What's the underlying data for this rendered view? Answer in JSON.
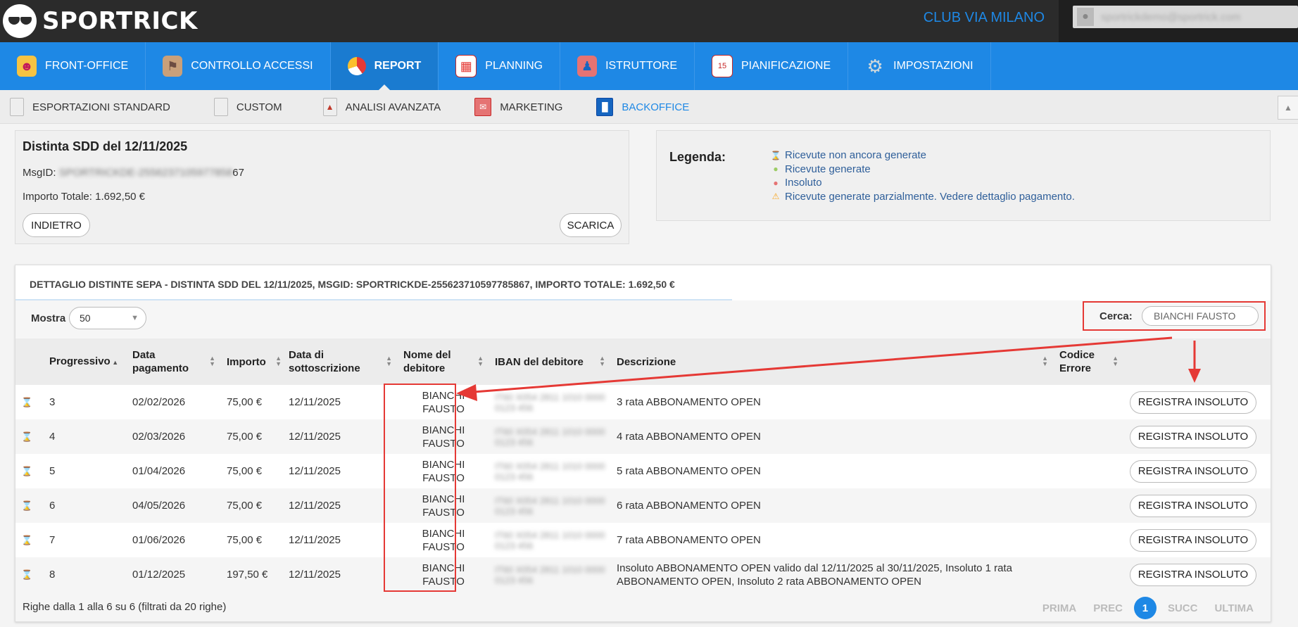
{
  "header": {
    "brand": "SPORTRICK",
    "club": "CLUB VIA MILANO",
    "user_email": "sportrickdemo@sportrick.com"
  },
  "main_nav": [
    {
      "label": "FRONT-OFFICE",
      "icon": "receptionist-icon"
    },
    {
      "label": "CONTROLLO ACCESSI",
      "icon": "access-control-icon"
    },
    {
      "label": "REPORT",
      "icon": "pie-chart-icon",
      "active": true
    },
    {
      "label": "PLANNING",
      "icon": "calendar-grid-icon"
    },
    {
      "label": "ISTRUTTORE",
      "icon": "instructors-icon"
    },
    {
      "label": "PIANIFICAZIONE",
      "icon": "calendar-icon"
    },
    {
      "label": "IMPOSTAZIONI",
      "icon": "gear-icon"
    }
  ],
  "sub_nav": [
    {
      "label": "ESPORTAZIONI STANDARD"
    },
    {
      "label": "CUSTOM"
    },
    {
      "label": "ANALISI AVANZATA"
    },
    {
      "label": "MARKETING"
    },
    {
      "label": "BACKOFFICE",
      "active": true
    }
  ],
  "info": {
    "title": "Distinta SDD del 12/11/2025",
    "msgid_label": "MsgID:",
    "msgid_hidden": "SPORTRICKDE-2556237105977858",
    "msgid_tail": "67",
    "importo": "Importo Totale: 1.692,50 €",
    "back_button": "INDIETRO",
    "download_button": "SCARICA"
  },
  "legend": {
    "title": "Legenda:",
    "items": [
      {
        "icon": "hourglass-icon",
        "text": "Ricevute non ancora generate"
      },
      {
        "icon": "coin-green-icon",
        "text": "Ricevute generate"
      },
      {
        "icon": "coin-red-icon",
        "text": "Insoluto"
      },
      {
        "icon": "warning-icon",
        "text": "Ricevute generate parzialmente. Vedere dettaglio pagamento."
      }
    ]
  },
  "card": {
    "title": "DETTAGLIO DISTINTE SEPA - DISTINTA SDD DEL 12/11/2025, MSGID: SPORTRICKDE-255623710597785867, IMPORTO TOTALE: 1.692,50 €",
    "mostra_label": "Mostra",
    "mostra_value": "50",
    "cerca_label": "Cerca:",
    "cerca_value": "BIANCHI FAUSTO"
  },
  "table": {
    "columns": [
      "Progressivo",
      "Data pagamento",
      "Importo",
      "Data di sottoscrizione",
      "Nome del debitore",
      "IBAN del debitore",
      "Descrizione",
      "Codice Errore"
    ],
    "action_label": "REGISTRA INSOLUTO",
    "rows": [
      {
        "prog": "3",
        "data": "02/02/2026",
        "importo": "75,00 €",
        "sott": "12/11/2025",
        "nome": "BIANCHI FAUSTO",
        "iban": "IT60 X054 2811 1010 0000 0123 456",
        "descr": "3 rata ABBONAMENTO OPEN"
      },
      {
        "prog": "4",
        "data": "02/03/2026",
        "importo": "75,00 €",
        "sott": "12/11/2025",
        "nome": "BIANCHI FAUSTO",
        "iban": "IT60 X054 2811 1010 0000 0123 456",
        "descr": "4 rata ABBONAMENTO OPEN"
      },
      {
        "prog": "5",
        "data": "01/04/2026",
        "importo": "75,00 €",
        "sott": "12/11/2025",
        "nome": "BIANCHI FAUSTO",
        "iban": "IT60 X054 2811 1010 0000 0123 456",
        "descr": "5 rata ABBONAMENTO OPEN"
      },
      {
        "prog": "6",
        "data": "04/05/2026",
        "importo": "75,00 €",
        "sott": "12/11/2025",
        "nome": "BIANCHI FAUSTO",
        "iban": "IT60 X054 2811 1010 0000 0123 456",
        "descr": "6 rata ABBONAMENTO OPEN"
      },
      {
        "prog": "7",
        "data": "01/06/2026",
        "importo": "75,00 €",
        "sott": "12/11/2025",
        "nome": "BIANCHI FAUSTO",
        "iban": "IT60 X054 2811 1010 0000 0123 456",
        "descr": "7 rata ABBONAMENTO OPEN"
      },
      {
        "prog": "8",
        "data": "01/12/2025",
        "importo": "197,50 €",
        "sott": "12/11/2025",
        "nome": "BIANCHI FAUSTO",
        "iban": "IT60 X054 2811 1010 0000 0123 456",
        "descr": "Insoluto ABBONAMENTO OPEN valido dal 12/11/2025 al 30/11/2025, Insoluto 1 rata ABBONAMENTO OPEN, Insoluto 2 rata ABBONAMENTO OPEN"
      }
    ]
  },
  "footer": {
    "info": "Righe dalla 1 alla 6 su 6 (filtrati da 20 righe)",
    "pager": {
      "first": "PRIMA",
      "prev": "PREC",
      "current": "1",
      "next": "SUCC",
      "last": "ULTIMA"
    }
  },
  "colors": {
    "accent": "#1e88e5",
    "highlight": "#e53935",
    "topbar": "#2b2b2b"
  }
}
